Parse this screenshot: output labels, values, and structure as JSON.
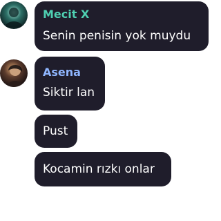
{
  "messages": [
    {
      "author": "Mecit X",
      "author_color": "#4fd0b2",
      "text": "Senin penisin yok muydu",
      "avatar": "dark-teal-avatar"
    },
    {
      "author": "Asena",
      "author_color": "#8fb6ff",
      "text": "Siktir lan",
      "avatar": "portrait-avatar"
    },
    {
      "text": "Pust"
    },
    {
      "text": "Kocamin rızkı onlar"
    }
  ],
  "colors": {
    "bubble": "#1f1d2b",
    "text": "#ffffff"
  }
}
